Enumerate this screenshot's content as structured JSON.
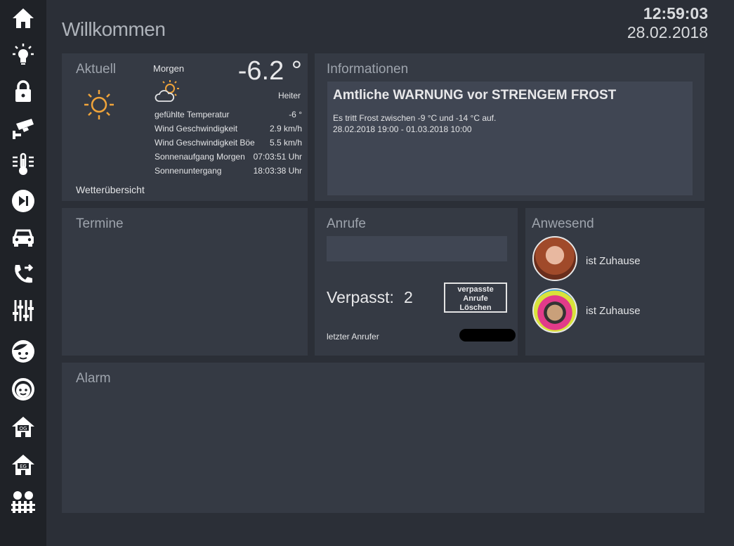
{
  "header": {
    "title": "Willkommen",
    "time": "12:59:03",
    "date": "28.02.2018"
  },
  "sidebar": {
    "items": [
      {
        "icon": "home-icon"
      },
      {
        "icon": "lightbulb-icon"
      },
      {
        "icon": "lock-icon"
      },
      {
        "icon": "security-camera-icon"
      },
      {
        "icon": "thermometer-icon"
      },
      {
        "icon": "play-skip-icon"
      },
      {
        "icon": "car-icon"
      },
      {
        "icon": "phone-forward-icon"
      },
      {
        "icon": "mixer-sliders-icon"
      },
      {
        "icon": "face-icon"
      },
      {
        "icon": "child-face-icon"
      },
      {
        "icon": "house-og-icon",
        "label": "OG"
      },
      {
        "icon": "house-eg-icon",
        "label": "EG"
      },
      {
        "icon": "garden-fence-icon"
      }
    ]
  },
  "weather": {
    "title": "Aktuell",
    "tomorrow_label": "Morgen",
    "temperature": "-6.2 °",
    "condition": "Heiter",
    "rows": [
      {
        "label": "gefühlte Temperatur",
        "value": "-6 °"
      },
      {
        "label": "Wind Geschwindigkeit",
        "value": "2.9 km/h"
      },
      {
        "label": "Wind Geschwindigkeit Böe",
        "value": "5.5 km/h"
      },
      {
        "label": "Sonnenaufgang Morgen",
        "value": "07:03:51 Uhr"
      },
      {
        "label": "Sonnenuntergang",
        "value": "18:03:38 Uhr"
      }
    ],
    "overview_link": "Wetterübersicht"
  },
  "info": {
    "title": "Informationen",
    "headline": "Amtliche WARNUNG vor STRENGEM FROST",
    "line1": "Es tritt Frost zwischen -9 °C und -14 °C auf.",
    "line2": "28.02.2018 19:00 - 01.03.2018 10:00"
  },
  "termine": {
    "title": "Termine"
  },
  "calls": {
    "title": "Anrufe",
    "missed_label": "Verpasst:",
    "missed_count": "2",
    "delete_button": [
      "verpasste",
      "Anrufe",
      "Löschen"
    ],
    "last_caller_label": "letzter Anrufer"
  },
  "presence": {
    "title": "Anwesend",
    "people": [
      {
        "status": "ist Zuhause"
      },
      {
        "status": "ist Zuhause"
      }
    ]
  },
  "alarm": {
    "title": "Alarm"
  },
  "colors": {
    "accent": "#f0a43a",
    "panel": "#353a44",
    "background": "#2b2f37",
    "sidebar": "#1f2227"
  }
}
